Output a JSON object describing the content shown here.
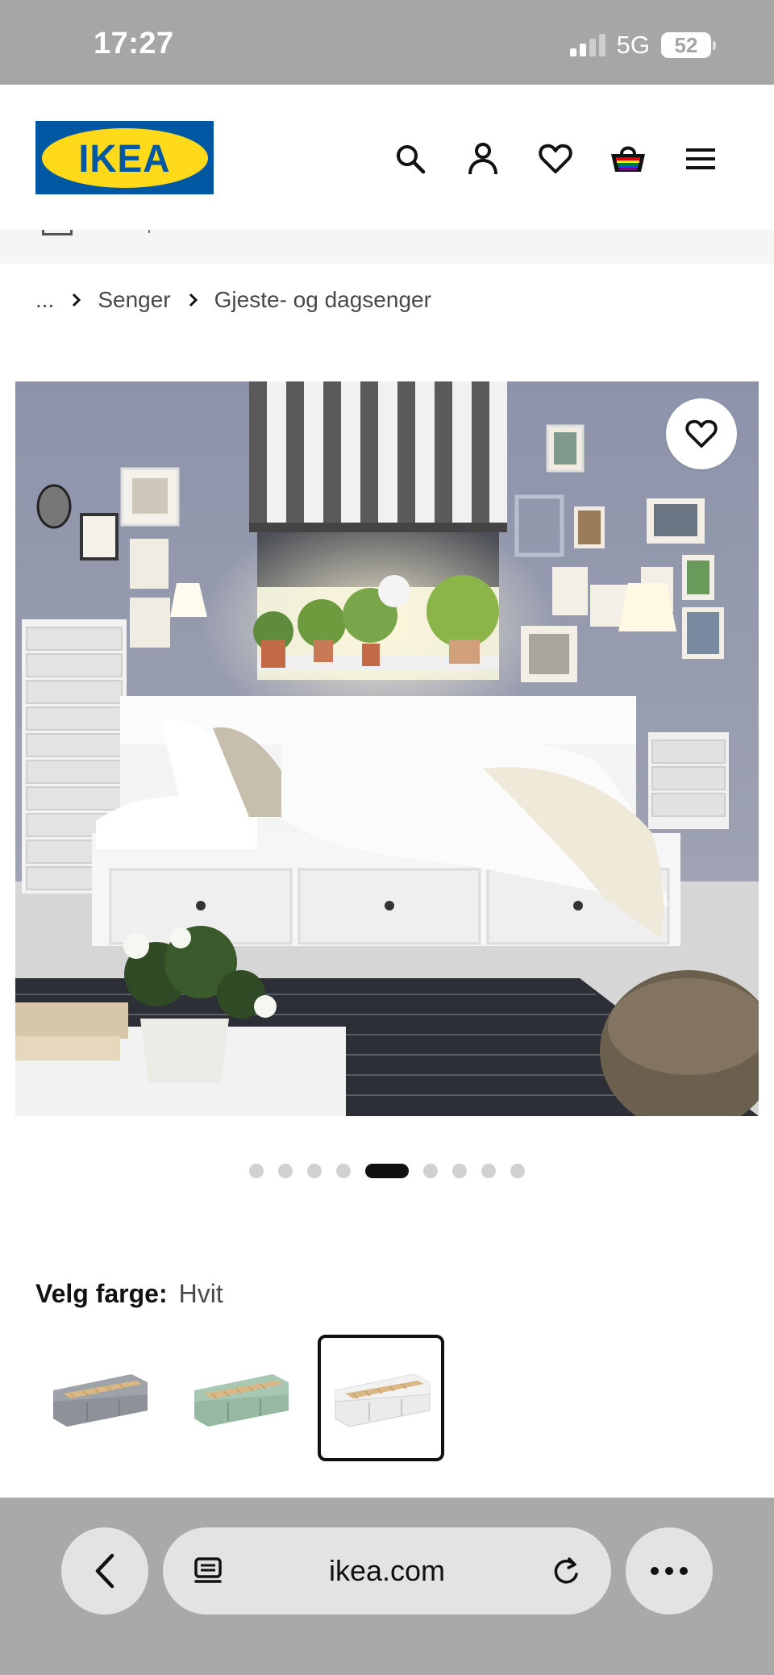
{
  "status_bar": {
    "time": "17:27",
    "network": "5G",
    "battery": "52"
  },
  "header": {
    "logo_text": "IKEA",
    "icons": [
      "search-icon",
      "user-icon",
      "heart-icon",
      "basket-icon",
      "menu-icon"
    ],
    "brand_colors": {
      "blue": "#0058a3",
      "yellow": "#ffda1a"
    }
  },
  "breadcrumb": {
    "ellipsis": "...",
    "items": [
      "Senger",
      "Gjeste- og dagsenger"
    ]
  },
  "gallery": {
    "dot_count": 9,
    "active_index": 4
  },
  "color_picker": {
    "label": "Velg farge:",
    "selected_value": "Hvit",
    "swatches": [
      {
        "color": "#9ea3aa",
        "selected": false
      },
      {
        "color": "#a8c8b4",
        "selected": false
      },
      {
        "color": "#f2f2f2",
        "selected": true
      }
    ]
  },
  "browser": {
    "url": "ikea.com"
  }
}
